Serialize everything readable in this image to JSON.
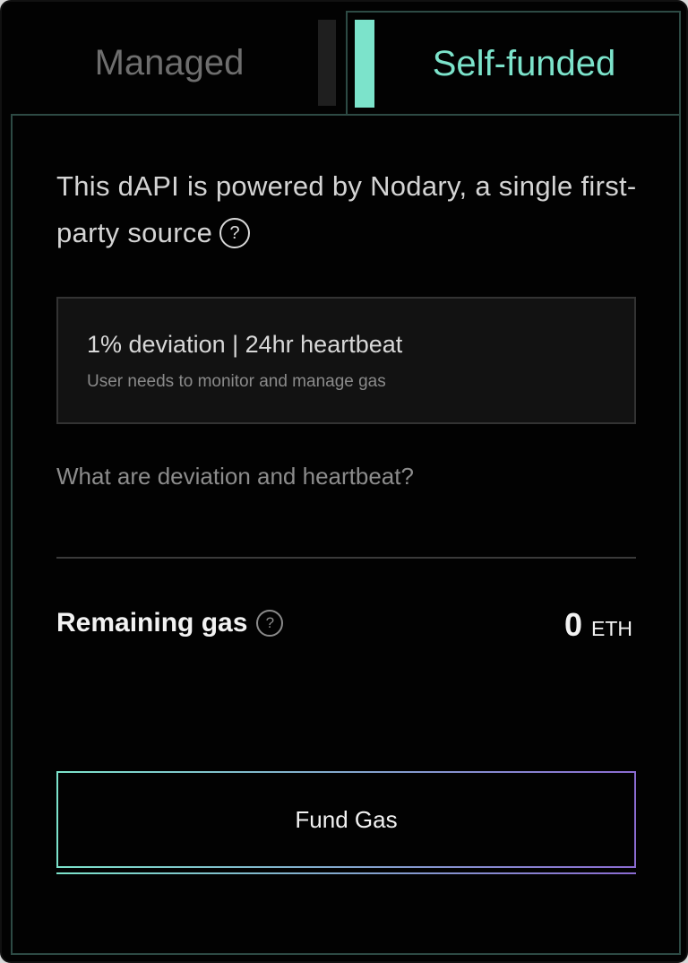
{
  "tabs": {
    "managed_label": "Managed",
    "self_funded_label": "Self-funded"
  },
  "description": {
    "text": "This dAPI is powered by Nodary, a single first-party source",
    "help_glyph": "?"
  },
  "config": {
    "title": "1% deviation | 24hr heartbeat",
    "subtitle": "User needs to monitor and manage gas"
  },
  "help_link": "What are deviation and heartbeat?",
  "gas": {
    "label": "Remaining gas",
    "help_glyph": "?",
    "value": "0",
    "unit": "ETH"
  },
  "fund_button": "Fund Gas",
  "colors": {
    "accent": "#7ce3cb",
    "gradient_end": "#8a6bd1",
    "background": "#020202"
  }
}
